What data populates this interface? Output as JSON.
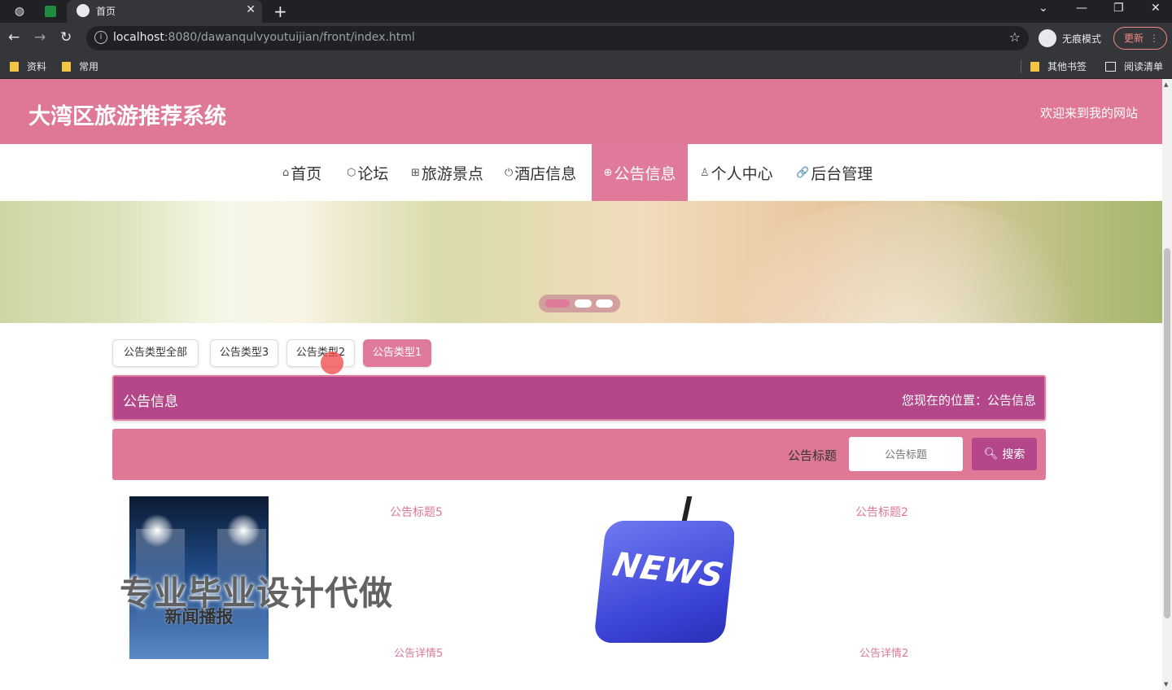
{
  "browser": {
    "tab_title": "首页",
    "new_tab": "+",
    "url_host": "localhost",
    "url_rest": ":8080/dawanqulvyoutuijian/front/index.html",
    "incognito_label": "无痕模式",
    "update_label": "更新",
    "bookmarks": [
      "资料",
      "常用"
    ],
    "other_bookmarks": "其他书签",
    "reading_list": "阅读清单"
  },
  "header": {
    "site_title": "大湾区旅游推荐系统",
    "welcome": "欢迎来到我的网站"
  },
  "nav": {
    "items": [
      {
        "icon": "⌂",
        "label": "首页"
      },
      {
        "icon": "⬡",
        "label": "论坛"
      },
      {
        "icon": "⊞",
        "label": "旅游景点"
      },
      {
        "icon": "⏻",
        "label": "酒店信息"
      },
      {
        "icon": "⊕",
        "label": "公告信息"
      },
      {
        "icon": "♙",
        "label": "个人中心"
      },
      {
        "icon": "🔗",
        "label": "后台管理"
      }
    ],
    "active_index": 4
  },
  "banner": {
    "slide_count": 3,
    "active_slide": 1
  },
  "type_tabs": [
    "公告类型全部",
    "公告类型3",
    "公告类型2",
    "公告类型1"
  ],
  "active_type_tab": 3,
  "section": {
    "title": "公告信息",
    "location": "您现在的位置：公告信息"
  },
  "search": {
    "label": "公告标题",
    "placeholder": "公告标题",
    "button": "搜索"
  },
  "cards": [
    {
      "title": "公告标题5",
      "detail": "公告详情5",
      "image_caption": "新闻播报"
    },
    {
      "title": "公告标题2",
      "detail": "公告详情2",
      "image_caption": "NEWS"
    }
  ],
  "watermark": "专业毕业设计代做",
  "colors": {
    "primary_pink": "#df7896",
    "accent_purple": "#b3478a"
  }
}
